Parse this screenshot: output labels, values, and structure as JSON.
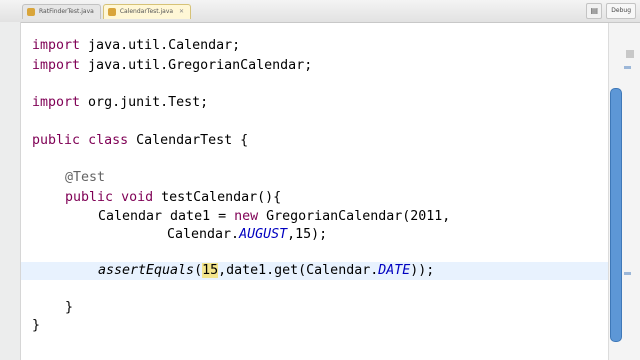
{
  "toolbar": {
    "tabs": [
      {
        "label": "RatFinderTest.java",
        "active": false
      },
      {
        "label": "CalendarTest.java",
        "active": true
      }
    ],
    "tab_close": "✕",
    "perspective_label": "Debug"
  },
  "editor": {
    "l1": {
      "kw": "import",
      "rest": " java.util.Calendar;"
    },
    "l2": {
      "kw": "import",
      "rest": " java.util.GregorianCalendar;"
    },
    "l4": {
      "kw": "import",
      "rest": " org.junit.Test;"
    },
    "l6": {
      "kw1": "public",
      "kw2": "class",
      "rest": " CalendarTest {"
    },
    "l8": {
      "annotation": "@Test"
    },
    "l9": {
      "kw1": "public",
      "kw2": "void",
      "rest": " testCalendar(){"
    },
    "l10": {
      "pre": "Calendar date1 = ",
      "kw": "new",
      "post": " GregorianCalendar(2011,"
    },
    "l11": {
      "pre": "Calendar.",
      "field": "AUGUST",
      "post": ",15);"
    },
    "l13": {
      "method": "assertEquals",
      "open": "(",
      "num": "15",
      "mid": ",date1.get(Calendar.",
      "field": "DATE",
      "close": "));"
    },
    "l15": {
      "text": "}"
    },
    "l16": {
      "text": "}"
    }
  },
  "colors": {
    "keyword": "#7f0055",
    "annotation": "#646464",
    "static_field": "#0000c0",
    "current_line": "#e8f2fe",
    "scrollbar": "#5d97d6"
  }
}
